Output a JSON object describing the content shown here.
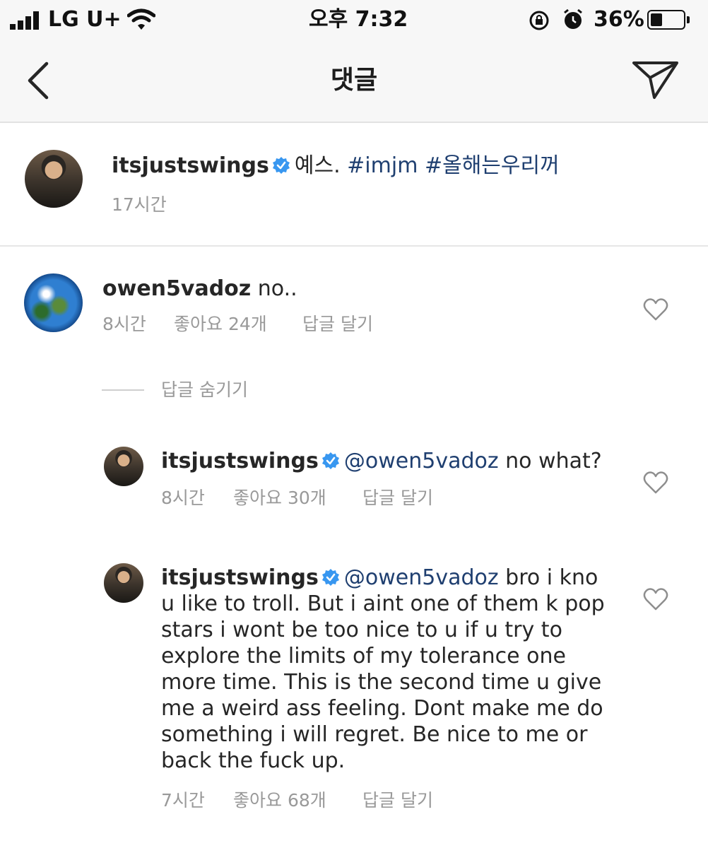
{
  "status_bar": {
    "carrier": "LG U+",
    "time": "오후 7:32",
    "battery": "36%",
    "battery_level": 0.36
  },
  "header": {
    "title": "댓글"
  },
  "caption": {
    "username": "itsjustswings",
    "text": "예스.",
    "hashtags": "#imjm #올해는우리꺼",
    "time": "17시간"
  },
  "comments": [
    {
      "username": "owen5vadoz",
      "text": "no..",
      "time": "8시간",
      "likes": "좋아요 24개",
      "reply": "답글 달기"
    }
  ],
  "hide_replies": "답글 숨기기",
  "replies": [
    {
      "username": "itsjustswings",
      "mention": "@owen5vadoz",
      "text": "no what?",
      "time": "8시간",
      "likes": "좋아요 30개",
      "reply": "답글 달기"
    },
    {
      "username": "itsjustswings",
      "mention": "@owen5vadoz",
      "text": "bro i kno u like to troll. But i aint one of them k pop stars i wont be too nice to u if u try to explore the limits of my tolerance one more time. This is the second time u give me a weird ass feeling. Dont make me do something i will regret. Be nice to me or back the fuck up.",
      "time": "7시간",
      "likes": "좋아요 68개",
      "reply": "답글 달기"
    }
  ],
  "colors": {
    "link": "#1f3f70",
    "verified": "#3897f0",
    "meta": "#999999",
    "header_bg": "#f7f7f7"
  }
}
